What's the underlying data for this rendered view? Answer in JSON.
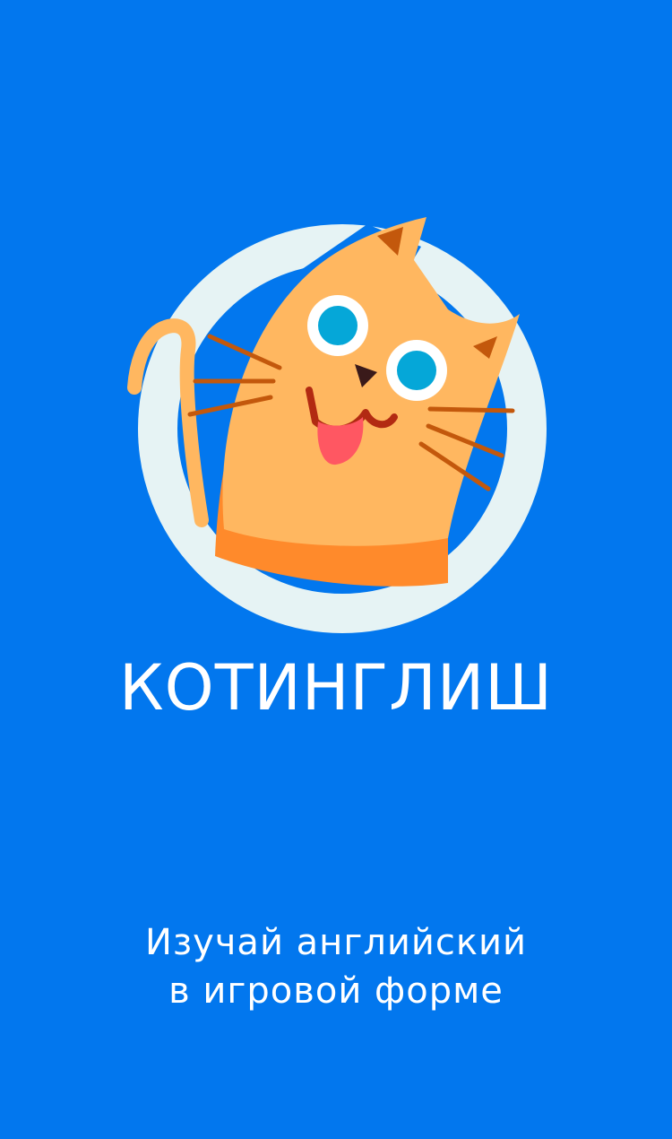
{
  "splash": {
    "app_name": "КОТИНГЛИШ",
    "tagline_line1": "Изучай английский",
    "tagline_line2": "в игровой форме",
    "logo_icon": "cat-logo-icon"
  },
  "colors": {
    "background": "#0277EE",
    "ring": "#E6F3F4",
    "cat_body": "#FFB760",
    "cat_shade": "#FF8A2B",
    "eye_iris": "#05A7D8",
    "tongue": "#FF5762",
    "whiskers": "#C3580C",
    "text": "#FFFFFF"
  }
}
